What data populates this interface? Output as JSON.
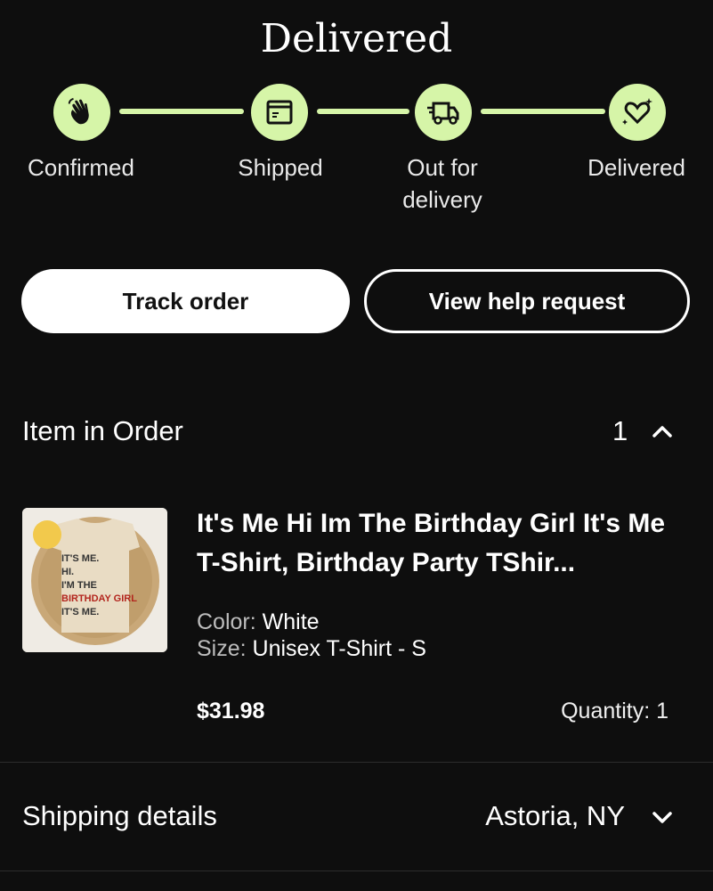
{
  "header": {
    "title": "Delivered"
  },
  "progress": {
    "accent_color": "#d6f5a8",
    "steps": [
      {
        "label": "Confirmed",
        "icon": "waving-hand-icon"
      },
      {
        "label": "Shipped",
        "icon": "package-box-icon"
      },
      {
        "label": "Out for delivery",
        "icon": "delivery-truck-icon"
      },
      {
        "label": "Delivered",
        "icon": "heart-sparkle-icon"
      }
    ]
  },
  "actions": {
    "track_order": "Track order",
    "view_help": "View help request"
  },
  "items_section": {
    "title": "Item in Order",
    "count": "1",
    "expanded": true
  },
  "item": {
    "title": "It's Me Hi Im The Birthday Girl It's Me T-Shirt, Birthday Party TShir...",
    "color_label": "Color:",
    "color_value": "White",
    "size_label": "Size:",
    "size_value": "Unisex T-Shirt - S",
    "price": "$31.98",
    "quantity": "Quantity: 1",
    "image_text": [
      "IT'S ME.",
      "HI.",
      "I'M THE",
      "BIRTHDAY GIRL",
      "IT'S ME."
    ]
  },
  "shipping": {
    "title": "Shipping details",
    "location": "Astoria, NY"
  }
}
